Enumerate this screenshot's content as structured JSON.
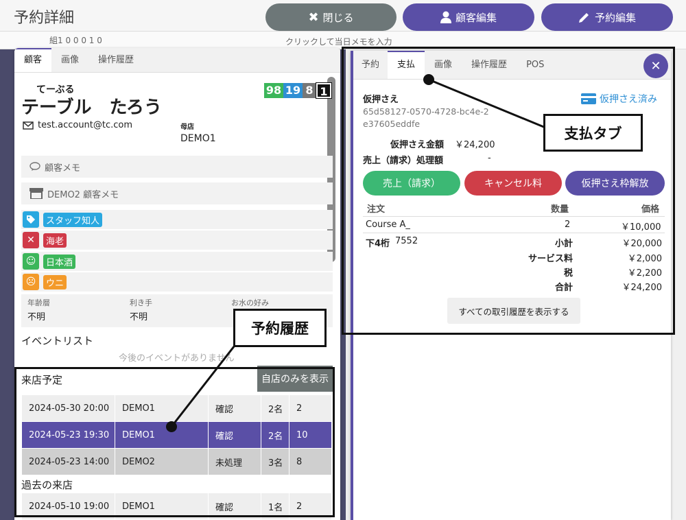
{
  "page_title": "予約詳細",
  "topbar": {
    "close_label": "閉じる",
    "customer_edit_label": "顧客編集",
    "reservation_edit_label": "予約編集"
  },
  "background": {
    "status_counts": "組1 0 0 0 1 0",
    "memo_placeholder": "クリックして当日メモを入力"
  },
  "left_tabs": [
    "顧客",
    "画像",
    "操作履歴"
  ],
  "customer": {
    "furigana": "てーぶる",
    "name": "テーブル　たろう",
    "email": "test.account@tc.com",
    "home_store_label": "母店",
    "home_store": "DEMO1",
    "counts": [
      "98",
      "19",
      "8",
      "1"
    ]
  },
  "memos": {
    "customer_memo": "顧客メモ",
    "store_memo": "DEMO2 顧客メモ"
  },
  "tags": [
    {
      "label": "スタッフ知人",
      "color": "#2aa8e0",
      "icon": "tag-icon"
    },
    {
      "label": "海老",
      "color": "#d03a48",
      "icon": "dislike-face-icon"
    },
    {
      "label": "日本酒",
      "color": "#3cb65a",
      "icon": "smile-face-icon"
    },
    {
      "label": "ウニ",
      "color": "#f39a2a",
      "icon": "frown-face-icon"
    }
  ],
  "prefs": {
    "age_label": "年齢層",
    "age_value": "不明",
    "hand_label": "利き手",
    "hand_value": "不明",
    "water_label": "お水の好み"
  },
  "events": {
    "title": "イベントリスト",
    "empty": "今後のイベントがありません"
  },
  "upcoming": {
    "title": "来店予定",
    "filter_label": "自店のみを表示",
    "rows": [
      {
        "datetime": "2024-05-30 20:00",
        "store": "DEMO1",
        "status": "確認",
        "people": "2名",
        "count": "2"
      },
      {
        "datetime": "2024-05-23 19:30",
        "store": "DEMO1",
        "status": "確認",
        "people": "2名",
        "count": "10"
      },
      {
        "datetime": "2024-05-23 14:00",
        "store": "DEMO2",
        "status": "未処理",
        "people": "3名",
        "count": "8"
      }
    ]
  },
  "past": {
    "title": "過去の来店",
    "rows": [
      {
        "datetime": "2024-05-10 19:00",
        "store": "DEMO1",
        "status": "確認",
        "people": "1名",
        "count": "2"
      }
    ]
  },
  "right_tabs": [
    "予約",
    "支払",
    "画像",
    "操作履歴",
    "POS"
  ],
  "payment": {
    "hold_title": "仮押さえ",
    "hold_id": "65d58127-0570-4728-bc4e-2e37605eddfe",
    "hold_status": "仮押さえ済み",
    "hold_amount_label": "仮押さえ金額",
    "hold_amount": "￥24,200",
    "sales_label": "売上（請求）処理額",
    "sales_value": "-",
    "btn_sales": "売上（請求）",
    "btn_cancel": "キャンセル料",
    "btn_release": "仮押さえ枠解放",
    "col_order": "注文",
    "col_qty": "数量",
    "col_price": "価格",
    "item_name": "Course A_",
    "item_qty": "2",
    "item_price": "￥10,000",
    "card_last4_label": "下4桁",
    "card_last4": "7552",
    "subtotal_label": "小計",
    "subtotal": "￥20,000",
    "service_label": "サービス料",
    "service": "￥2,000",
    "tax_label": "税",
    "tax": "￥2,200",
    "total_label": "合計",
    "total": "￥24,200",
    "history_button": "すべての取引履歴を表示する"
  },
  "annotations": {
    "payment_tab": "支払タブ",
    "reservation_history": "予約履歴"
  },
  "colors": {
    "purple": "#5a4fa6",
    "green": "#3cb874",
    "red": "#cf3e48",
    "gray_button": "#6d7778"
  }
}
